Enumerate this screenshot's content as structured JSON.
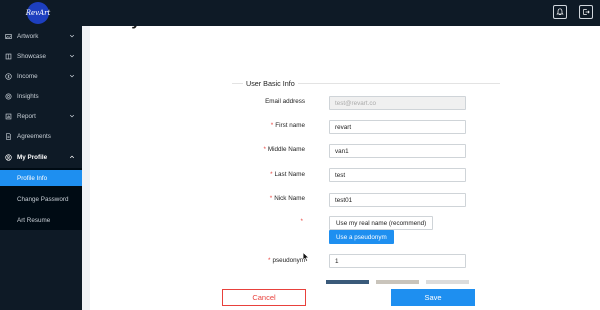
{
  "app": {
    "logo_text": "RevArt"
  },
  "sidebar": {
    "items": [
      {
        "label": "Artwork",
        "icon": "image-icon",
        "has_chevron": true
      },
      {
        "label": "Showcase",
        "icon": "book-icon",
        "has_chevron": true
      },
      {
        "label": "Income",
        "icon": "dollar-icon",
        "has_chevron": true
      },
      {
        "label": "Insights",
        "icon": "insights-icon",
        "has_chevron": false
      },
      {
        "label": "Report",
        "icon": "report-icon",
        "has_chevron": true
      },
      {
        "label": "Agreements",
        "icon": "document-icon",
        "has_chevron": false
      },
      {
        "label": "My Profile",
        "icon": "user-icon",
        "has_chevron": true
      }
    ],
    "submenu": [
      {
        "label": "Profile Info",
        "active": true
      },
      {
        "label": "Change Password",
        "active": false
      },
      {
        "label": "Art Resume",
        "active": false
      }
    ]
  },
  "page": {
    "title": "My Profile"
  },
  "form": {
    "section_title": "User Basic Info",
    "email": {
      "label": "Email address",
      "value": "test@revart.co"
    },
    "first_name": {
      "label": "First name",
      "value": "revart"
    },
    "middle_name": {
      "label": "Middle Name",
      "value": "van1"
    },
    "last_name": {
      "label": "Last Name",
      "value": "test"
    },
    "nick_name": {
      "label": "Nick Name",
      "value": "test01"
    },
    "name_choice": {
      "label": "",
      "options": [
        "Use my real name (recommend)",
        "Use a pseudonym"
      ],
      "selected": "Use a pseudonym"
    },
    "pseudonym": {
      "label": "pseudonym",
      "value": "1"
    }
  },
  "actions": {
    "cancel_label": "Cancel",
    "save_label": "Save"
  },
  "colors": {
    "sidebar_bg": "#0e1a26",
    "accent": "#1e8ff0",
    "danger": "#e8413c"
  }
}
